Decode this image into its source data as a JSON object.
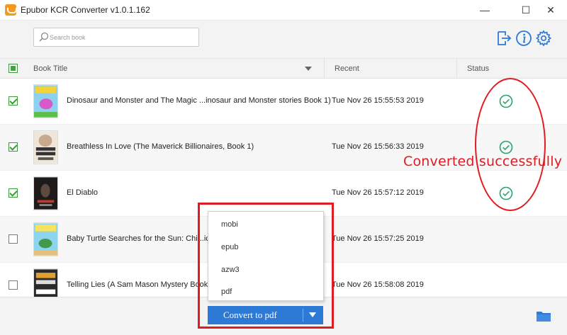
{
  "window": {
    "title": "Epubor KCR Converter v1.0.1.162",
    "minimize": "—",
    "maximize": "☐",
    "close": "✕"
  },
  "toolbar": {
    "search_placeholder": "Search book",
    "icons": [
      "exit-icon",
      "info-icon",
      "gear-icon"
    ]
  },
  "table": {
    "headers": {
      "title": "Book Title",
      "recent": "Recent",
      "status": "Status"
    },
    "rows": [
      {
        "checked": true,
        "title": "Dinosaur and Monster and The Magic ...inosaur and Monster stories Book 1)",
        "recent": "Tue Nov 26 15:55:53 2019",
        "status": "converted"
      },
      {
        "checked": true,
        "title": "Breathless In Love (The Maverick Billionaires, Book 1)",
        "recent": "Tue Nov 26 15:56:33 2019",
        "status": "converted"
      },
      {
        "checked": true,
        "title": "El Diablo",
        "recent": "Tue Nov 26 15:57:12 2019",
        "status": "converted"
      },
      {
        "checked": false,
        "title": "Baby Turtle Searches for the Sun: Chi...icture",
        "recent": "Tue Nov 26 15:57:25 2019",
        "status": ""
      },
      {
        "checked": false,
        "title": "Telling Lies (A Sam Mason Mystery Book 1)",
        "recent": "Tue Nov 26 15:58:08 2019",
        "status": ""
      }
    ]
  },
  "dropdown": {
    "options": [
      "mobi",
      "epub",
      "azw3",
      "pdf"
    ],
    "convert_label": "Convert to pdf"
  },
  "annotation": {
    "text": "Converted successfully",
    "color": "#e11b22"
  },
  "colors": {
    "accent": "#2d7ad6",
    "check_green": "#3a9a3a",
    "status_green": "#2aa36b",
    "annotation_red": "#e11b22"
  }
}
